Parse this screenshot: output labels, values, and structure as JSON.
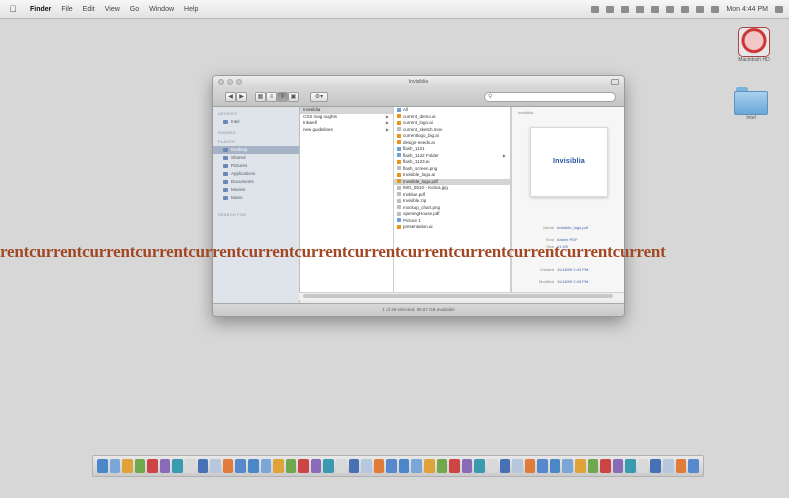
{
  "menubar": {
    "app_name": "Finder",
    "menus": [
      "File",
      "Edit",
      "View",
      "Go",
      "Window",
      "Help"
    ],
    "clock": "Mon 4:44 PM"
  },
  "desktop": {
    "icons": [
      {
        "label": "Macintosh HD"
      },
      {
        "label": "Intel"
      }
    ]
  },
  "window": {
    "title": "Invisiblia",
    "search_placeholder": "Q",
    "sidebar": {
      "devices_head": "DEVICES",
      "devices": [
        {
          "label": "Intel"
        }
      ],
      "shared_head": "SHARED",
      "places_head": "PLACES",
      "places": [
        {
          "label": "Desktop"
        },
        {
          "label": "Shared"
        },
        {
          "label": "Pictures"
        },
        {
          "label": "Applications"
        },
        {
          "label": "Documents"
        },
        {
          "label": "Movies"
        },
        {
          "label": "Music"
        }
      ],
      "search_head": "SEARCH FOR"
    },
    "column1": [
      {
        "label": "Invisiblia",
        "sel": true
      },
      {
        "label": "CSS mag oughts",
        "arrow": true
      },
      {
        "label": "Inkwell",
        "arrow": true
      },
      {
        "label": "new guidelines",
        "arrow": true
      }
    ],
    "column2": [
      {
        "label": "All"
      },
      {
        "label": "current_demo.ai"
      },
      {
        "label": "current_logo.ai"
      },
      {
        "label": "current_sketch.mov"
      },
      {
        "label": "currentlogo_big.ai"
      },
      {
        "label": "design-needs.ai"
      },
      {
        "label": "flash_1121"
      },
      {
        "label": "flash_1122 Folder"
      },
      {
        "label": "flash_1123.ai"
      },
      {
        "label": "flash_screen.png"
      },
      {
        "label": "Invisible_logo.ai"
      },
      {
        "label": "Invisible_logo.pdf",
        "sel": true
      },
      {
        "label": "IMG_5510 - Kotica.jpg"
      },
      {
        "label": "Invblue.pdf"
      },
      {
        "label": "Invisible.zip"
      },
      {
        "label": "mockup_chart.png"
      },
      {
        "label": "openingHouse.pdf"
      },
      {
        "label": "Picture 1"
      },
      {
        "label": "presentation.ai"
      }
    ],
    "preview": {
      "header": "Invisiblia",
      "thumb_text": "Invisiblia",
      "info": [
        {
          "key": "Name",
          "value": "Invisible_logo.pdf"
        },
        {
          "key": "Kind",
          "value": "Adobe PDF"
        },
        {
          "key": "Size",
          "value": "41 KB"
        },
        {
          "key": "Created",
          "value": "11/18/09 2:43 PM"
        },
        {
          "key": "Modified",
          "value": "11/18/09 2:43 PM"
        }
      ]
    },
    "status": "1 of 39 selected, 98.67 GB available"
  },
  "watermark": "rentcurrentcurrentcurrentcurrentcurrentcurrentcurrentcurrentcurrentcurrentcurrentcurrent",
  "dock": {
    "count": 48
  }
}
